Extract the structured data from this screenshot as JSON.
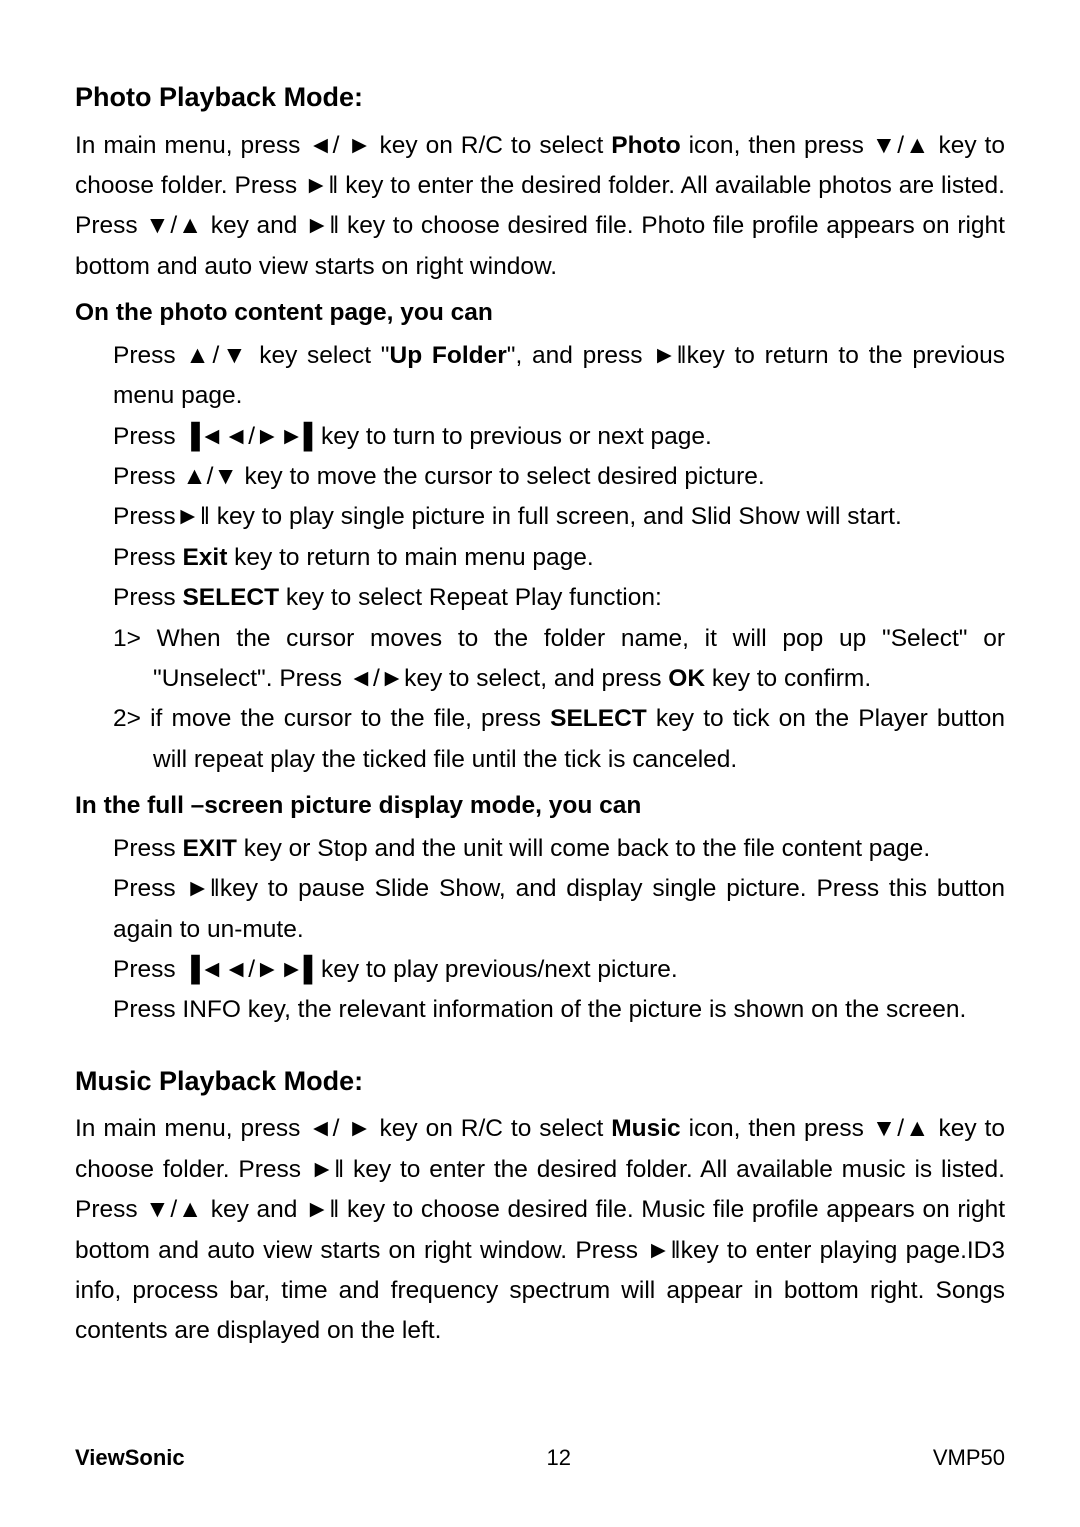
{
  "photo": {
    "heading": "Photo Playback Mode:",
    "intro_p1": "In main menu, press ◄/ ► key on R/C to select ",
    "intro_bold1": "Photo",
    "intro_p2": " icon, then press ▼/▲ key to choose folder. Press ►‖ key to enter the desired folder. All available photos are listed. Press ▼/▲ key and ►‖ key to choose desired file. Photo file profile appears on right bottom and auto view starts on right window.",
    "sub1": "On the photo content page, you can",
    "line1a": "Press ▲/▼ key select \"",
    "line1b": "Up Folder",
    "line1c": "\", and press ►‖key to return to the previous menu page.",
    "line2": "Press ▐◄◄/►►▌key to turn to previous or next page.",
    "line3": "Press ▲/▼ key to move the cursor to select desired picture.",
    "line4": "Press►‖ key to play single picture in full screen, and Slid Show will start.",
    "line5a": "Press ",
    "line5b": "Exit",
    "line5c": " key to return to main menu page.",
    "line6a": "Press ",
    "line6b": "SELECT",
    "line6c": " key to select Repeat Play function:",
    "num1a": "1>  When the cursor moves to the folder name, it will pop up \"Select\" or \"Unselect\". Press ◄/►key to select, and press ",
    "num1b": "OK",
    "num1c": " key to confirm.",
    "num2a": "2>  if move the cursor to the file, press ",
    "num2b": "SELECT",
    "num2c": " key to tick on the Player button will repeat play the ticked file until the tick is canceled.",
    "sub2": "In the full –screen picture display mode, you can",
    "fs1a": "Press ",
    "fs1b": "EXIT",
    "fs1c": " key or Stop and the unit will come back to the file content page.",
    "fs2": "Press ►‖key to pause Slide Show, and display single picture. Press this button again to un-mute.",
    "fs3": "Press ▐◄◄/►►▌key to play previous/next picture.",
    "fs4": "Press INFO key, the relevant information of the picture is shown on the screen."
  },
  "music": {
    "heading": "Music Playback Mode:",
    "intro_p1": "In main menu, press ◄/ ► key on R/C to select ",
    "intro_bold1": "Music",
    "intro_p2": " icon, then press ▼/▲ key to choose folder. Press ►‖ key to enter the desired folder. All available music is listed. Press ▼/▲ key and ►‖ key to choose desired file. Music file profile appears on right bottom and auto view starts on right window. Press ►‖key to enter playing page.ID3 info, process bar, time and frequency spectrum will appear in bottom right. Songs contents are displayed on the left."
  },
  "footer": {
    "brand": "ViewSonic",
    "page": "12",
    "model": "VMP50"
  }
}
